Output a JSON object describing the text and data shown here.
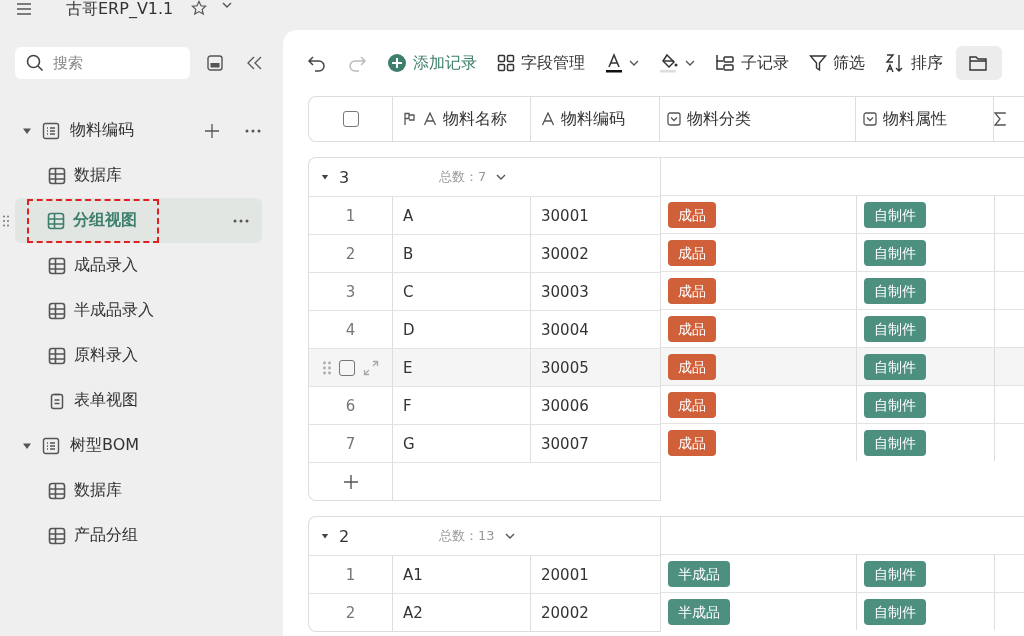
{
  "app": {
    "title": "古哥ERP_V1.1",
    "starred": false
  },
  "sidebar": {
    "search": {
      "placeholder": "搜索"
    },
    "tree": [
      {
        "label": "物料编码",
        "kind": "folder",
        "expanded": true,
        "children": [
          {
            "label": "数据库",
            "kind": "grid",
            "selected": false,
            "highlighted": false
          },
          {
            "label": "分组视图",
            "kind": "grid",
            "selected": true,
            "highlighted": true
          },
          {
            "label": "成品录入",
            "kind": "grid",
            "selected": false,
            "highlighted": false
          },
          {
            "label": "半成品录入",
            "kind": "grid",
            "selected": false,
            "highlighted": false
          },
          {
            "label": "原料录入",
            "kind": "grid",
            "selected": false,
            "highlighted": false
          },
          {
            "label": "表单视图",
            "kind": "form",
            "selected": false,
            "highlighted": false
          }
        ]
      },
      {
        "label": "树型BOM",
        "kind": "folder",
        "expanded": true,
        "children": [
          {
            "label": "数据库",
            "kind": "grid",
            "selected": false,
            "highlighted": false
          },
          {
            "label": "产品分组",
            "kind": "grid",
            "selected": false,
            "highlighted": false
          }
        ]
      }
    ]
  },
  "toolbar": [
    {
      "kind": "undo",
      "disabled": false
    },
    {
      "kind": "redo",
      "disabled": true
    },
    {
      "kind": "add",
      "label": "添加记录"
    },
    {
      "kind": "fields",
      "label": "字段管理"
    },
    {
      "kind": "text-color"
    },
    {
      "kind": "fill-color"
    },
    {
      "kind": "subrecord",
      "label": "子记录"
    },
    {
      "kind": "filter",
      "label": "筛选"
    },
    {
      "kind": "sort",
      "label": "排序"
    },
    {
      "kind": "group"
    }
  ],
  "table": {
    "select_all": {
      "checked": false
    },
    "columns": [
      {
        "label": "物料名称",
        "kind": "text",
        "primary": true
      },
      {
        "label": "物料编码",
        "kind": "text"
      },
      {
        "label": "物料分类",
        "kind": "select"
      },
      {
        "label": "物料属性",
        "kind": "select"
      },
      {
        "kind": "formula"
      }
    ],
    "groups": [
      {
        "name": "3",
        "count_label": "总数：",
        "count": "7",
        "expanded": true,
        "rows": [
          {
            "index": "1",
            "name": "A",
            "code": "30001",
            "category": {
              "label": "成品",
              "color": "#d0603a"
            },
            "attribute": {
              "label": "自制件",
              "color": "#4e9080"
            },
            "hovered": false
          },
          {
            "index": "2",
            "name": "B",
            "code": "30002",
            "category": {
              "label": "成品",
              "color": "#d0603a"
            },
            "attribute": {
              "label": "自制件",
              "color": "#4e9080"
            },
            "hovered": false
          },
          {
            "index": "3",
            "name": "C",
            "code": "30003",
            "category": {
              "label": "成品",
              "color": "#d0603a"
            },
            "attribute": {
              "label": "自制件",
              "color": "#4e9080"
            },
            "hovered": false
          },
          {
            "index": "4",
            "name": "D",
            "code": "30004",
            "category": {
              "label": "成品",
              "color": "#d0603a"
            },
            "attribute": {
              "label": "自制件",
              "color": "#4e9080"
            },
            "hovered": false
          },
          {
            "name": "E",
            "code": "30005",
            "category": {
              "label": "成品",
              "color": "#d0603a"
            },
            "attribute": {
              "label": "自制件",
              "color": "#4e9080"
            },
            "hovered": true
          },
          {
            "index": "6",
            "name": "F",
            "code": "30006",
            "category": {
              "label": "成品",
              "color": "#d0603a"
            },
            "attribute": {
              "label": "自制件",
              "color": "#4e9080"
            },
            "hovered": false
          },
          {
            "index": "7",
            "name": "G",
            "code": "30007",
            "category": {
              "label": "成品",
              "color": "#d0603a"
            },
            "attribute": {
              "label": "自制件",
              "color": "#4e9080"
            },
            "hovered": false
          }
        ],
        "add_row": true
      },
      {
        "name": "2",
        "count_label": "总数：",
        "count": "13",
        "expanded": true,
        "rows": [
          {
            "index": "1",
            "name": "A1",
            "code": "20001",
            "category": {
              "label": "半成品",
              "color": "#4e9080"
            },
            "attribute": {
              "label": "自制件",
              "color": "#4e9080"
            },
            "hovered": false
          },
          {
            "index": "2",
            "name": "A2",
            "code": "20002",
            "category": {
              "label": "半成品",
              "color": "#4e9080"
            },
            "attribute": {
              "label": "自制件",
              "color": "#4e9080"
            },
            "hovered": false
          }
        ]
      }
    ]
  }
}
